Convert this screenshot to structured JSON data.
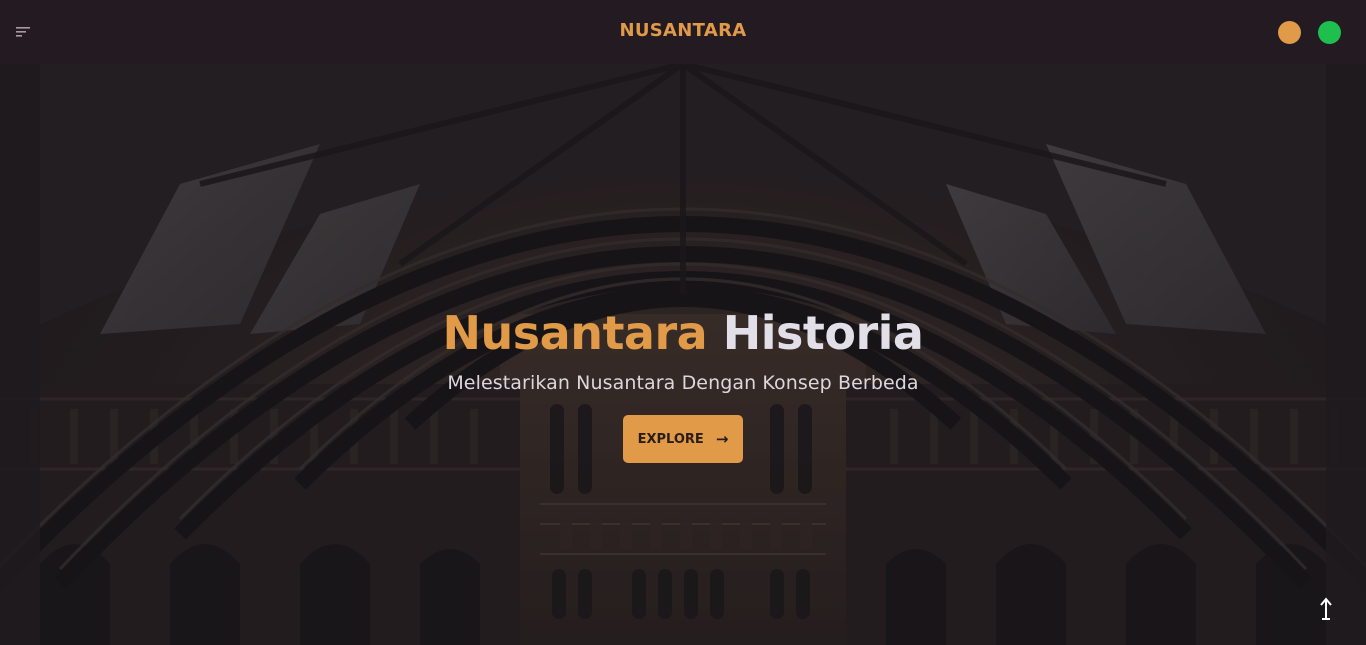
{
  "navbar": {
    "brand": "NUSANTARA",
    "menu_icon": "menu-icon",
    "accent_color": "#e09a48",
    "theme_dot_orange": "#e09a48",
    "theme_dot_green": "#1fbf4f"
  },
  "hero": {
    "title_part1": "Nusantara",
    "title_part2": "Historia",
    "subtitle": "Melestarikan Nusantara Dengan Konsep Berbeda",
    "explore_label": "EXPLORE",
    "explore_icon": "arrow-right-icon",
    "scroll_icon": "arrow-up-icon"
  }
}
